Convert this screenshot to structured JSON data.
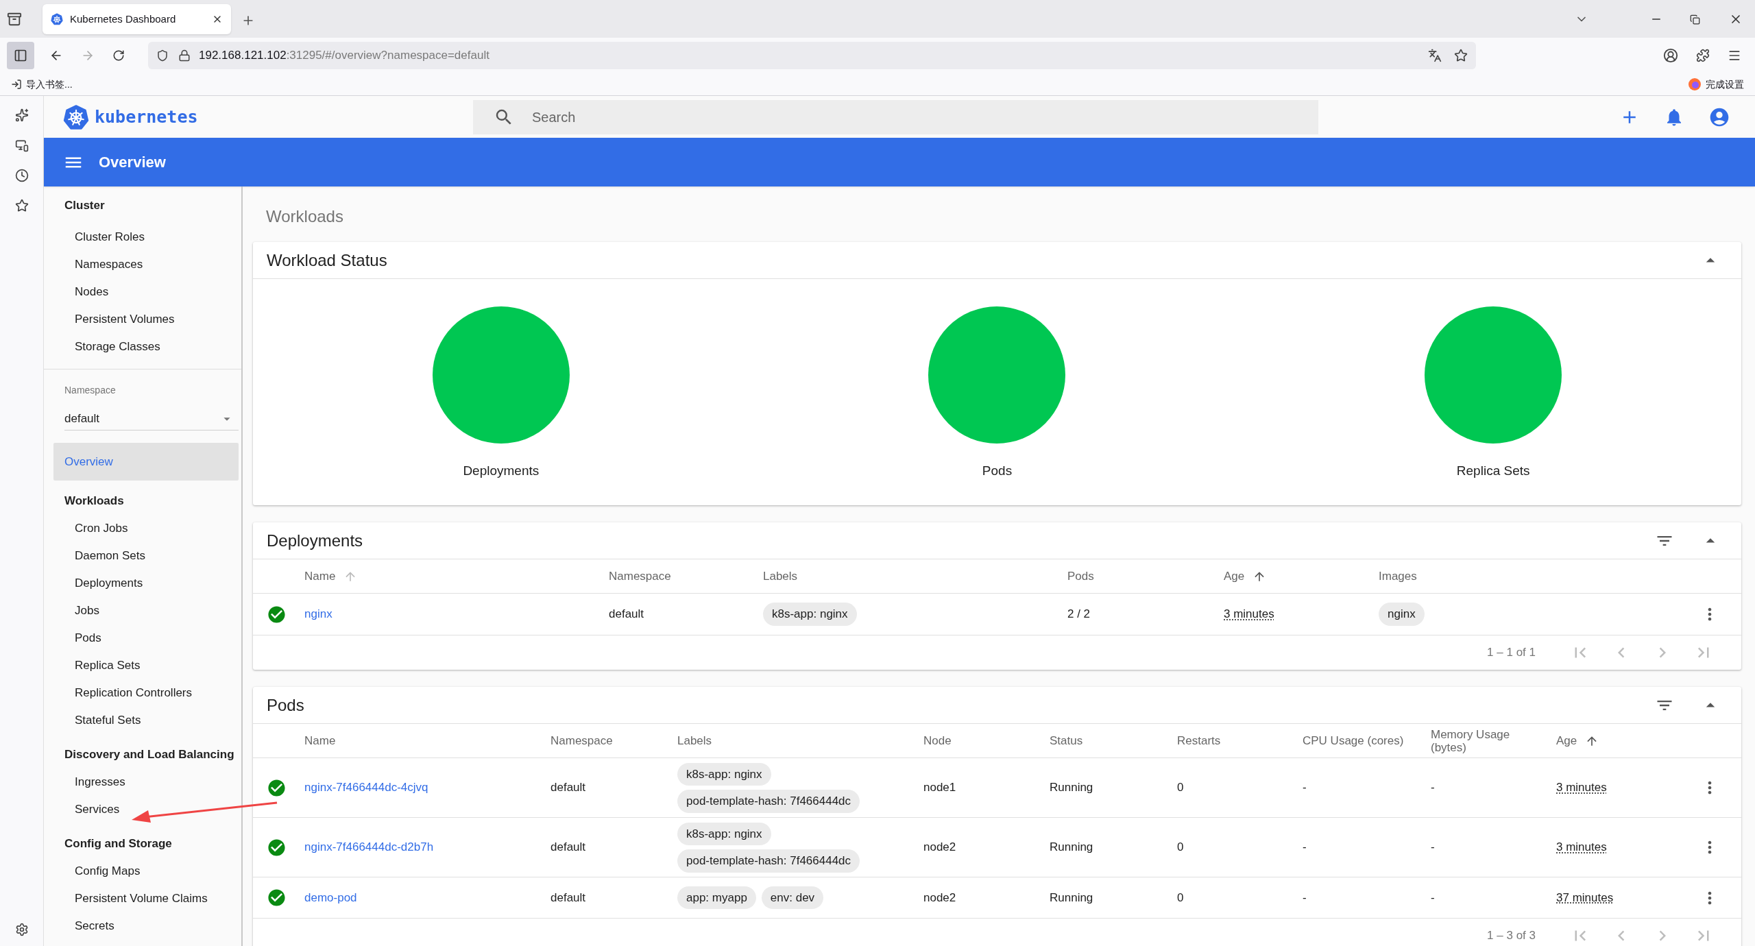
{
  "browser": {
    "tab_title": "Kubernetes Dashboard",
    "url_host": "192.168.121.102",
    "url_rest": ":31295/#/overview?namespace=default",
    "bookmark": "导入书签...",
    "setup": "完成设置"
  },
  "header": {
    "brand": "kubernetes",
    "search_placeholder": "Search"
  },
  "toolbar": {
    "title": "Overview"
  },
  "sidebar": {
    "cluster": {
      "title": "Cluster",
      "items": [
        {
          "label": "Cluster Roles",
          "selected": false
        },
        {
          "label": "Namespaces",
          "selected": false
        },
        {
          "label": "Nodes",
          "selected": false
        },
        {
          "label": "Persistent Volumes",
          "selected": false
        },
        {
          "label": "Storage Classes",
          "selected": false
        }
      ]
    },
    "namespace": {
      "label": "Namespace",
      "value": "default"
    },
    "nav": [
      {
        "kind": "link",
        "label": "Overview",
        "selected": true
      },
      {
        "kind": "header",
        "label": "Workloads"
      },
      {
        "kind": "item",
        "label": "Cron Jobs",
        "selected": false
      },
      {
        "kind": "item",
        "label": "Daemon Sets",
        "selected": false
      },
      {
        "kind": "item",
        "label": "Deployments",
        "selected": false
      },
      {
        "kind": "item",
        "label": "Jobs",
        "selected": false
      },
      {
        "kind": "item",
        "label": "Pods",
        "selected": false
      },
      {
        "kind": "item",
        "label": "Replica Sets",
        "selected": false
      },
      {
        "kind": "item",
        "label": "Replication Controllers",
        "selected": false
      },
      {
        "kind": "item",
        "label": "Stateful Sets",
        "selected": false
      },
      {
        "kind": "header",
        "label": "Discovery and Load Balancing"
      },
      {
        "kind": "item",
        "label": "Ingresses",
        "selected": false
      },
      {
        "kind": "item",
        "label": "Services",
        "selected": false
      },
      {
        "kind": "header",
        "label": "Config and Storage"
      },
      {
        "kind": "item",
        "label": "Config Maps",
        "selected": false
      },
      {
        "kind": "item",
        "label": "Persistent Volume Claims",
        "selected": false
      },
      {
        "kind": "item",
        "label": "Secrets",
        "selected": false
      }
    ]
  },
  "content": {
    "title": "Workloads",
    "workload_status": {
      "title": "Workload Status",
      "expanded": true,
      "items": [
        {
          "label": "Deployments"
        },
        {
          "label": "Pods"
        },
        {
          "label": "Replica Sets"
        }
      ]
    },
    "deployments": {
      "title": "Deployments",
      "expanded": true,
      "columns": [
        {
          "label": "Name",
          "sort_active": false
        },
        {
          "label": "Namespace"
        },
        {
          "label": "Labels"
        },
        {
          "label": "Pods"
        },
        {
          "label": "Age",
          "sort_active": true
        },
        {
          "label": "Images"
        }
      ],
      "rows": [
        {
          "ok": true,
          "name": "nginx",
          "namespace": "default",
          "labels": [
            "k8s-app: nginx"
          ],
          "pods": "2 / 2",
          "age": "3 minutes",
          "images": [
            "nginx"
          ]
        }
      ],
      "pagination": "1 – 1 of 1"
    },
    "pods": {
      "title": "Pods",
      "expanded": true,
      "columns": [
        {
          "label": "Name"
        },
        {
          "label": "Namespace"
        },
        {
          "label": "Labels"
        },
        {
          "label": "Node"
        },
        {
          "label": "Status"
        },
        {
          "label": "Restarts"
        },
        {
          "label": "CPU Usage (cores)"
        },
        {
          "label": "Memory Usage (bytes)"
        },
        {
          "label": "Age",
          "sort_active": true
        }
      ],
      "rows": [
        {
          "ok": true,
          "name": "nginx-7f466444dc-4cjvq",
          "namespace": "default",
          "labels": [
            "k8s-app: nginx",
            "pod-template-hash: 7f466444dc"
          ],
          "node": "node1",
          "status": "Running",
          "restarts": "0",
          "cpu": "-",
          "memory": "-",
          "age": "3 minutes"
        },
        {
          "ok": true,
          "name": "nginx-7f466444dc-d2b7h",
          "namespace": "default",
          "labels": [
            "k8s-app: nginx",
            "pod-template-hash: 7f466444dc"
          ],
          "node": "node2",
          "status": "Running",
          "restarts": "0",
          "cpu": "-",
          "memory": "-",
          "age": "3 minutes"
        },
        {
          "ok": true,
          "name": "demo-pod",
          "namespace": "default",
          "labels": [
            "app: myapp",
            "env: dev"
          ],
          "node": "node2",
          "status": "Running",
          "restarts": "0",
          "cpu": "-",
          "memory": "-",
          "age": "37 minutes"
        }
      ],
      "pagination": "1 – 3 of 3"
    }
  }
}
